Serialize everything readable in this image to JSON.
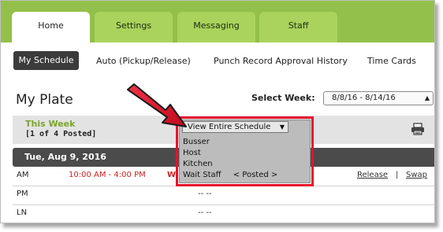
{
  "tabs": [
    {
      "label": "Home",
      "active": true
    },
    {
      "label": "Settings",
      "active": false
    },
    {
      "label": "Messaging",
      "active": false
    },
    {
      "label": "Staff",
      "active": false
    }
  ],
  "subnav": {
    "my_schedule": "My Schedule",
    "auto_pickup": "Auto (Pickup/Release)",
    "punch_history": "Punch Record Approval History",
    "time_cards": "Time Cards"
  },
  "page": {
    "title": "My Plate",
    "select_week_label": "Select Week:",
    "selected_week": "8/8/16 - 8/14/16"
  },
  "week_bar": {
    "this_week": "This Week",
    "posted_count": "[1 of 4 Posted]",
    "print_icon": "printer-icon"
  },
  "dropdown": {
    "selected": "View Entire Schedule",
    "options": [
      "Busser",
      "Host",
      "Kitchen",
      "Wait Staff"
    ],
    "posted_tag": "< Posted >"
  },
  "day": {
    "title": "Tue, Aug 9, 2016",
    "rows": [
      {
        "label": "AM",
        "time": "10:00 AM - 4:00 PM",
        "extra": "W",
        "release": "Release",
        "separator": "|",
        "swap": "Swap"
      },
      {
        "label": "PM",
        "value": "-- --"
      },
      {
        "label": "LN",
        "value": "-- --"
      }
    ]
  },
  "colors": {
    "tab_bar": "#93c04a",
    "accent_green": "#7aa52f",
    "shift_red": "#cc1f1f",
    "callout_red": "#e8112d"
  }
}
